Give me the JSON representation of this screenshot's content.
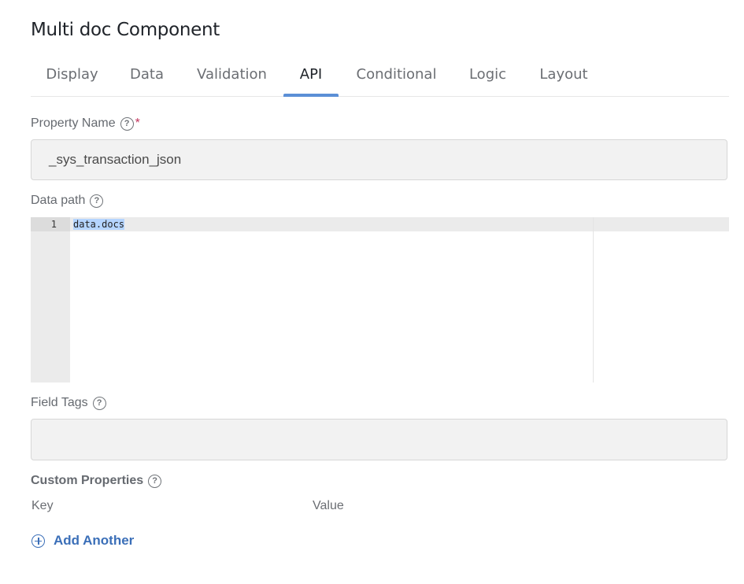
{
  "title": "Multi doc Component",
  "tabs": [
    {
      "label": "Display"
    },
    {
      "label": "Data"
    },
    {
      "label": "Validation"
    },
    {
      "label": "API",
      "active": true
    },
    {
      "label": "Conditional"
    },
    {
      "label": "Logic"
    },
    {
      "label": "Layout"
    }
  ],
  "property_name": {
    "label": "Property Name",
    "required_mark": "*",
    "help_icon": "?",
    "value": "_sys_transaction_json"
  },
  "data_path": {
    "label": "Data path",
    "help_icon": "?",
    "line_number": "1",
    "code": "data.docs"
  },
  "field_tags": {
    "label": "Field Tags",
    "help_icon": "?",
    "value": ""
  },
  "custom_properties": {
    "label": "Custom Properties",
    "help_icon": "?",
    "key_header": "Key",
    "value_header": "Value"
  },
  "add_another": {
    "label": "Add Another",
    "icon": "plus-circle-icon"
  },
  "colors": {
    "accent": "#5b8fd6",
    "link": "#3b6fb8",
    "required": "#c0335b",
    "selection": "#b5d5ff"
  }
}
